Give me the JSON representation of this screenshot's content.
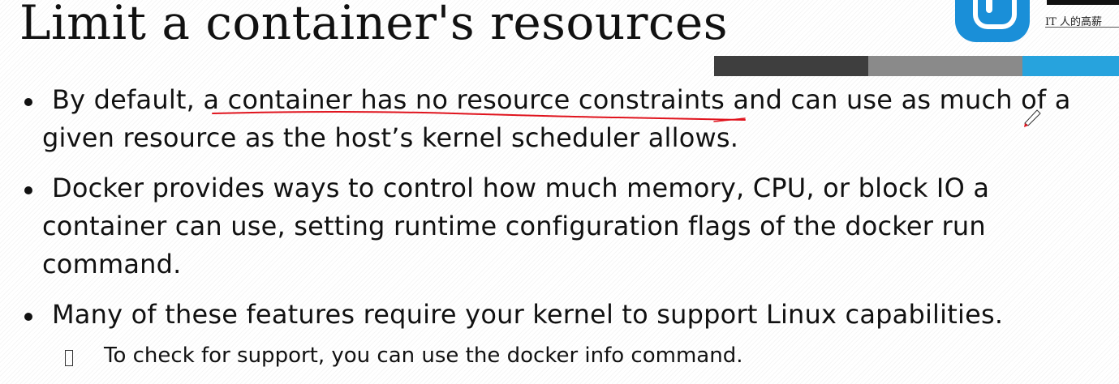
{
  "slide": {
    "title": "Limit a container's resources",
    "logo_caption": "IT 人的高薪"
  },
  "bullets": [
    {
      "lines": [
        "By default, a container has no resource constraints and can use as much of a",
        "given resource as the host’s kernel scheduler allows."
      ]
    },
    {
      "lines": [
        "Docker provides ways to control how much memory, CPU, or block IO a",
        "container can use, setting runtime configuration flags of the docker run",
        "command."
      ]
    },
    {
      "lines": [
        "Many of these features require your kernel to support Linux capabilities."
      ]
    }
  ],
  "sub_bullet": {
    "text": "To check for support, you can use the docker info command."
  },
  "colors": {
    "bar_dark": "#3e3e3e",
    "bar_mid": "#8a8a8a",
    "bar_blue": "#27a3dd",
    "annotation_red": "#e0141e",
    "logo_blue": "#1a8fd8"
  }
}
